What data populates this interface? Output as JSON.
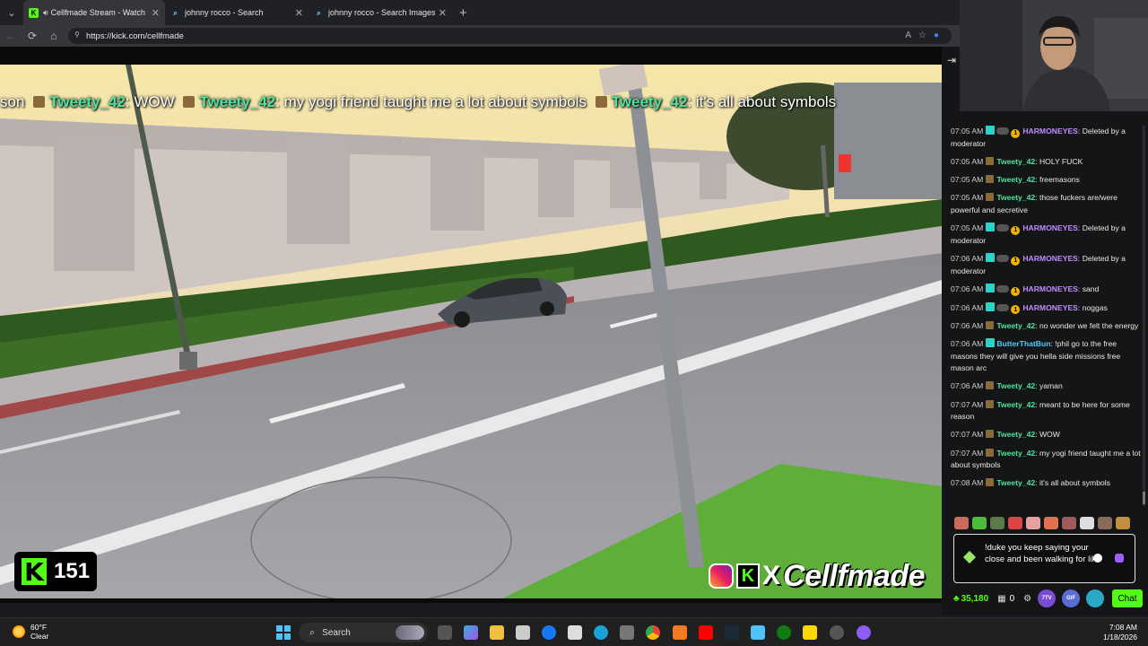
{
  "browser": {
    "tabs": [
      {
        "title": "Cellfmade Stream - Watch Li",
        "active": true,
        "favicon": "kick-icon"
      },
      {
        "title": "johnny rocco - Search",
        "active": false,
        "favicon": "bing-icon"
      },
      {
        "title": "johnny rocco - Search Images",
        "active": false,
        "favicon": "bing-icon"
      }
    ],
    "url": "https://kick.com/cellfmade"
  },
  "stream": {
    "ticker": [
      {
        "user": "",
        "text": "son"
      },
      {
        "user": "Tweety_42",
        "text": "WOW"
      },
      {
        "user": "Tweety_42",
        "text": "my yogi friend taught me a lot about symbols"
      },
      {
        "user": "Tweety_42",
        "text": "it's all about symbols"
      }
    ],
    "viewer_count": "151",
    "brand_name": "Cellfmade",
    "brand_x": "X"
  },
  "chat": {
    "colors": {
      "green": "#4fe3a0",
      "purple": "#c18cff",
      "blue": "#58c9ff"
    },
    "messages": [
      {
        "time": "07:05 AM",
        "user": "HARMONEYES",
        "color": "#c18cff",
        "badges": "sub",
        "text": "Deleted by a moderator"
      },
      {
        "time": "07:05 AM",
        "user": "Tweety_42",
        "color": "#4fe3a0",
        "badges": "cube",
        "text": "HOLY FUCK"
      },
      {
        "time": "07:05 AM",
        "user": "Tweety_42",
        "color": "#4fe3a0",
        "badges": "cube",
        "text": "freemasons"
      },
      {
        "time": "07:05 AM",
        "user": "Tweety_42",
        "color": "#4fe3a0",
        "badges": "cube",
        "text": "those fuckers are/were powerful and secretive"
      },
      {
        "time": "07:05 AM",
        "user": "HARMONEYES",
        "color": "#c18cff",
        "badges": "sub",
        "text": "Deleted by a moderator"
      },
      {
        "time": "07:06 AM",
        "user": "HARMONEYES",
        "color": "#c18cff",
        "badges": "sub",
        "text": "Deleted by a moderator"
      },
      {
        "time": "07:06 AM",
        "user": "HARMONEYES",
        "color": "#c18cff",
        "badges": "sub",
        "text": "sand"
      },
      {
        "time": "07:06 AM",
        "user": "HARMONEYES",
        "color": "#c18cff",
        "badges": "sub",
        "text": "noggas"
      },
      {
        "time": "07:06 AM",
        "user": "Tweety_42",
        "color": "#4fe3a0",
        "badges": "cube",
        "text": "no wonder we felt the energy"
      },
      {
        "time": "07:06 AM",
        "user": "ButterThatBun",
        "color": "#58c9ff",
        "badges": "subonly",
        "text": "!phil go to the free masons they will give you hella side missions free mason arc"
      },
      {
        "time": "07:06 AM",
        "user": "Tweety_42",
        "color": "#4fe3a0",
        "badges": "cube",
        "text": "yaman"
      },
      {
        "time": "07:07 AM",
        "user": "Tweety_42",
        "color": "#4fe3a0",
        "badges": "cube",
        "text": "meant to be here for some reason"
      },
      {
        "time": "07:07 AM",
        "user": "Tweety_42",
        "color": "#4fe3a0",
        "badges": "cube",
        "text": "WOW"
      },
      {
        "time": "07:07 AM",
        "user": "Tweety_42",
        "color": "#4fe3a0",
        "badges": "cube",
        "text": "my yogi friend taught me a lot about symbols"
      },
      {
        "time": "07:08 AM",
        "user": "Tweety_42",
        "color": "#4fe3a0",
        "badges": "cube",
        "text": "it's all about symbols"
      }
    ],
    "input_value": "!duke you keep saying your close and been walking for like",
    "points": "35,180",
    "counter": "0",
    "send_label": "Chat",
    "badge_7tv": "7TV",
    "badge_other": "GIF"
  },
  "taskbar": {
    "weather_temp": "60°F",
    "weather_desc": "Clear",
    "search_placeholder": "Search",
    "time": "7:08 AM",
    "date": "1/18/2026"
  }
}
